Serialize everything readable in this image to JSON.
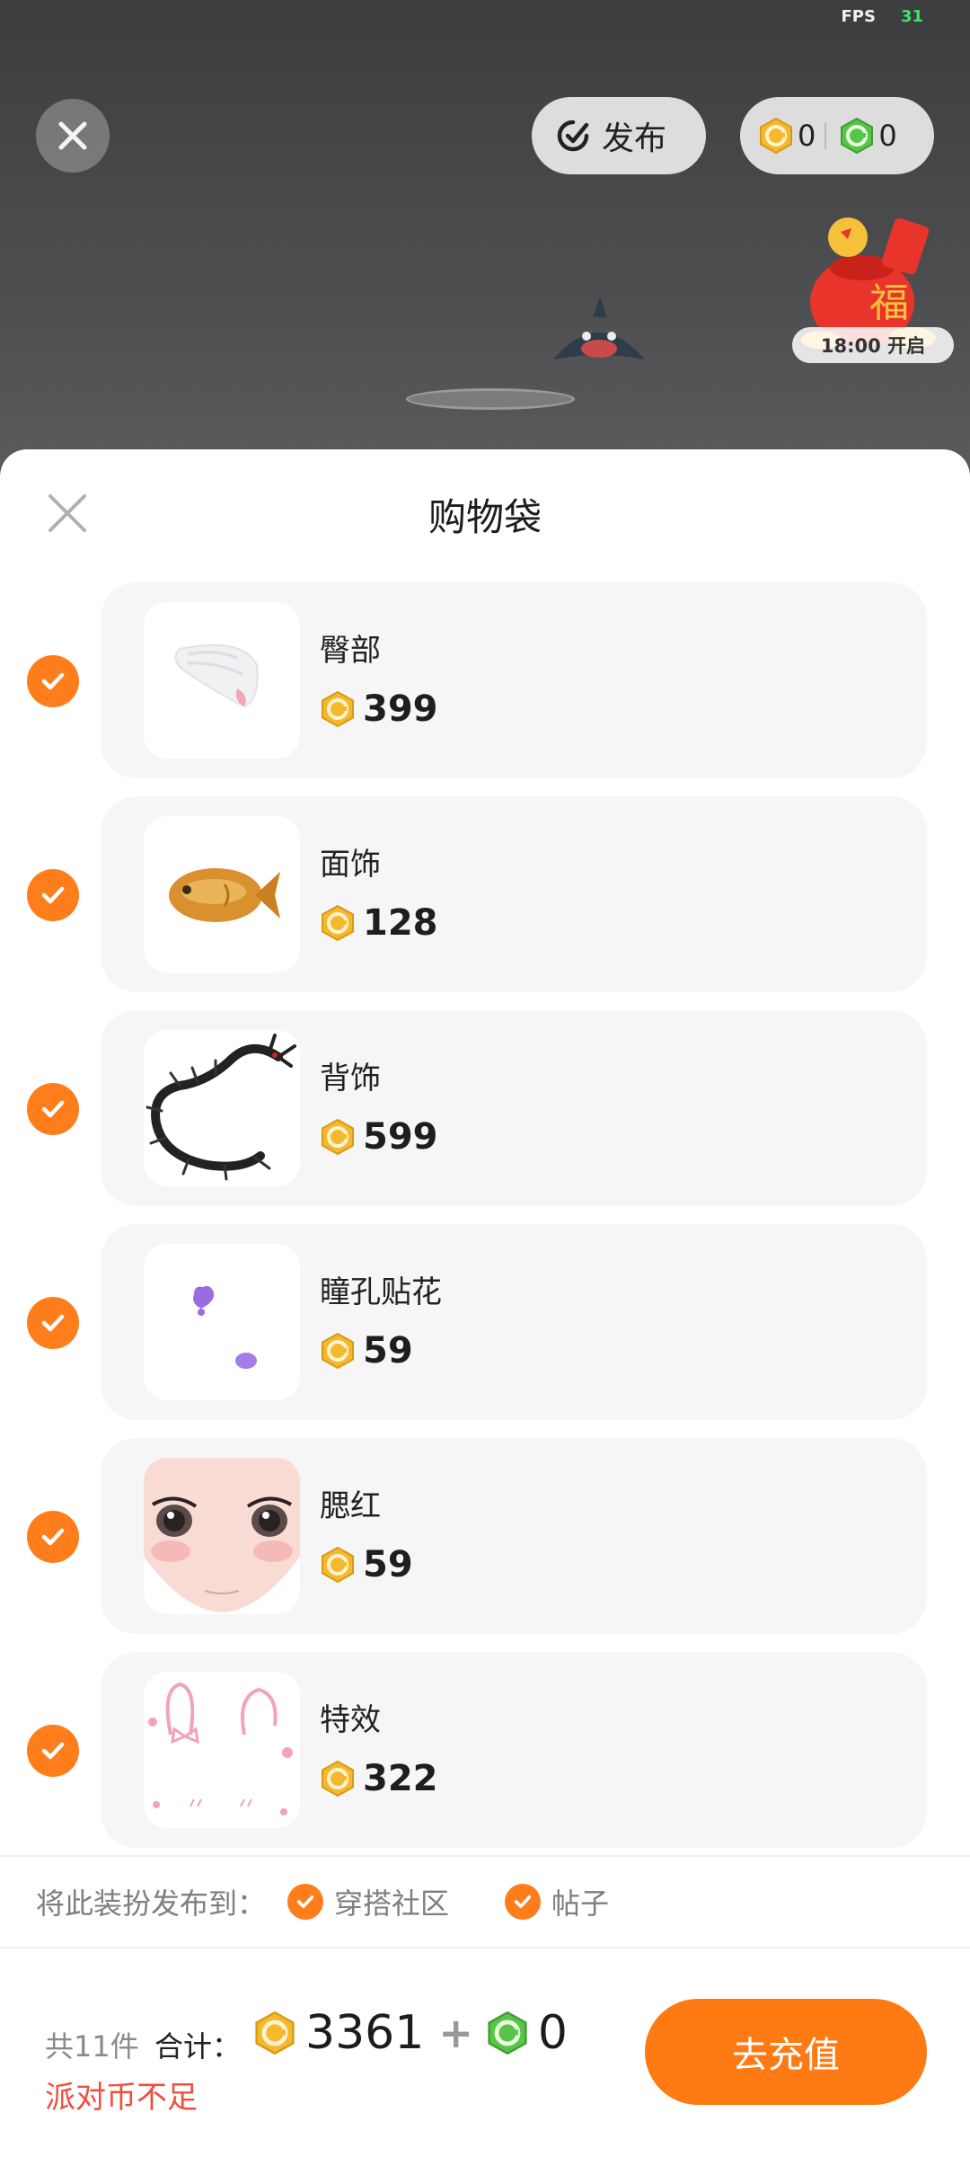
{
  "status": {
    "fps_label": "FPS",
    "fps_value": "31"
  },
  "top_bar": {
    "publish_label": "发布",
    "gold_balance": "0",
    "green_balance": "0",
    "event_timer": "18:00 开启"
  },
  "sheet": {
    "title": "购物袋",
    "items": [
      {
        "name": "臀部",
        "price": "399",
        "icon": "tail-icon"
      },
      {
        "name": "面饰",
        "price": "128",
        "icon": "fish-cake-icon"
      },
      {
        "name": "背饰",
        "price": "599",
        "icon": "dragon-icon"
      },
      {
        "name": "瞳孔贴花",
        "price": "59",
        "icon": "heart-decal-icon"
      },
      {
        "name": "腮红",
        "price": "59",
        "icon": "face-blush-icon"
      },
      {
        "name": "特效",
        "price": "322",
        "icon": "bunny-effect-icon"
      }
    ],
    "publish_to_label": "将此装扮发布到：",
    "publish_options": [
      "穿搭社区",
      "帖子"
    ]
  },
  "footer": {
    "count": "共11件",
    "total_label": "合计：",
    "gold_total": "3361",
    "plus": "+",
    "green_total": "0",
    "warning": "派对币不足",
    "recharge_label": "去充值"
  },
  "colors": {
    "accent": "#ff7d1a",
    "warning": "#f24d3c",
    "coin_gold": "#f5b82e",
    "coin_green": "#59c44a"
  }
}
